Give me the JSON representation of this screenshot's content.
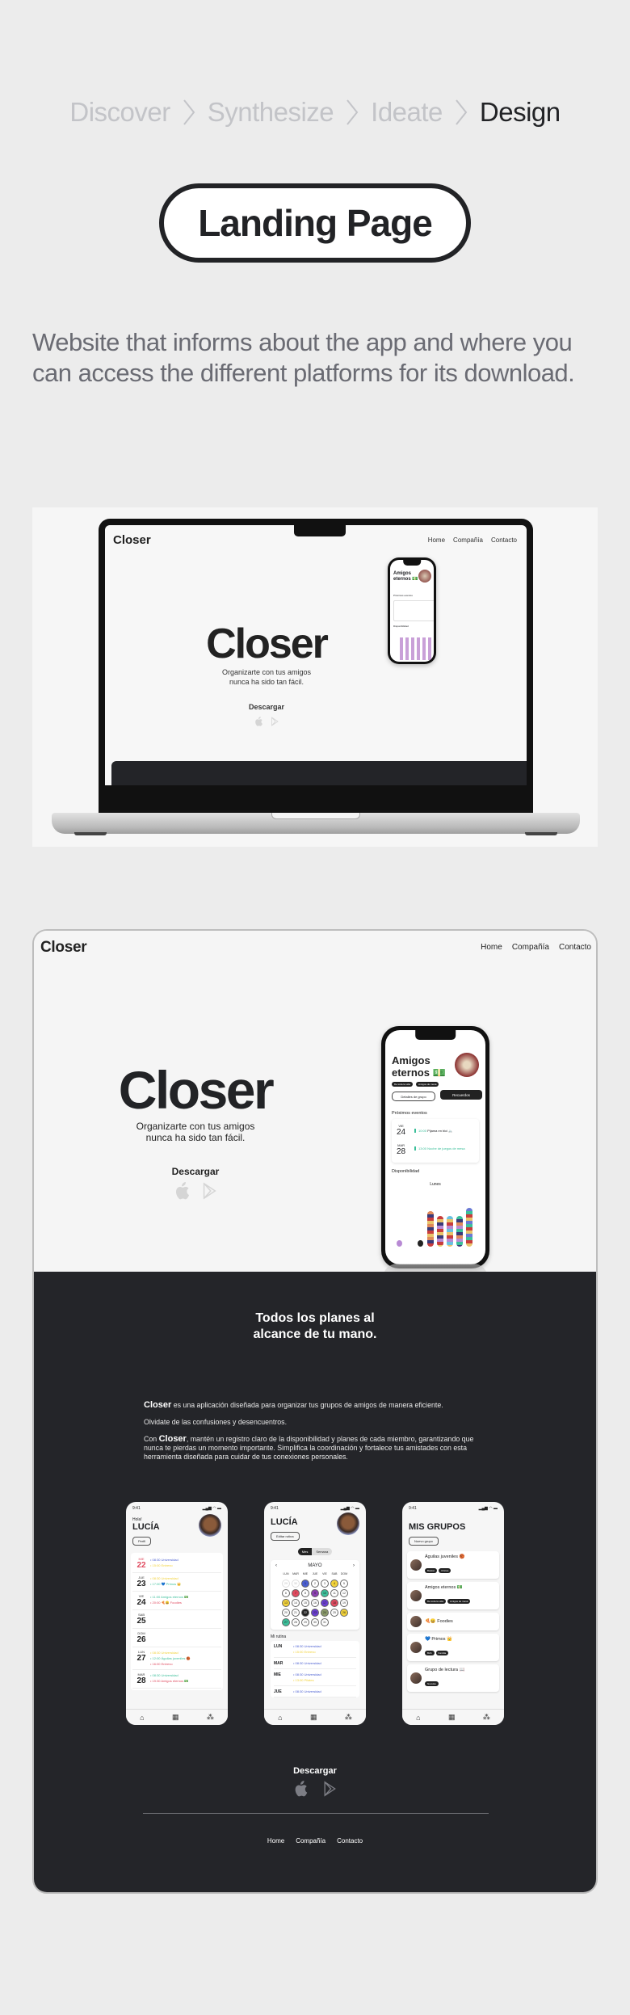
{
  "breadcrumb": {
    "items": [
      "Discover",
      "Synthesize",
      "Ideate",
      "Design"
    ],
    "active_index": 3
  },
  "section_title": "Landing Page",
  "description": "Website that informs about the app and where you can access the different platforms for its download.",
  "site": {
    "logo": "Closer",
    "nav": [
      "Home",
      "Compañía",
      "Contacto"
    ],
    "hero_title": "Closer",
    "hero_subtitle_line1": "Organizarte con tus amigos",
    "hero_subtitle_line2": "nunca ha sido tan fácil.",
    "download_label": "Descargar",
    "store_icons": [
      "apple-icon",
      "google-play-icon"
    ],
    "tagline_line1": "Todos los planes al",
    "tagline_line2": "alcance de tu mano.",
    "about": {
      "p1_brand": "Closer",
      "p1_text": " es una aplicación diseñada para organizar tus grupos de amigos de manera eficiente.",
      "p2": "Olvidate de las confusiones y desencuentros.",
      "p3_prefix": "Con ",
      "p3_brand": "Closer",
      "p3_text": ", mantén un registro claro de la disponibilidad y planes de cada miembro, garantizando que nunca te pierdas un momento importante. Simplifica la coordinación y fortalece tus amistades con esta herramienta diseñada para cuidar de tus conexiones personales."
    },
    "footer_download_label": "Descargar",
    "footer_nav": [
      "Home",
      "Compañía",
      "Contacto"
    ]
  },
  "hero_phone": {
    "group_title_line1": "Amigos",
    "group_title_line2": "eternos 💵",
    "tags": [
      "De toda la vida",
      "Amigos de mesa"
    ],
    "btn_details": "Detalles de grupo",
    "btn_memories": "Recuerdos",
    "events_title": "Próximos eventos",
    "events": [
      {
        "day": "VIE",
        "num": "24",
        "time": "10:00",
        "title": "Pijama en bici 🚲"
      },
      {
        "day": "MAR",
        "num": "28",
        "time": "13:00",
        "title": "Noche de juegos de mesa"
      }
    ],
    "availability_title": "Disponibilidad",
    "availability_day": "Lunes"
  },
  "screens": {
    "home": {
      "time": "9:41",
      "greeting": "Hola!",
      "name": "LUCÍA",
      "profile_btn": "Perfil",
      "days": [
        {
          "day": "MIE",
          "num": "22",
          "events": [
            "08:30 Universidad",
            "15:00 Entreno"
          ],
          "highlight": true
        },
        {
          "day": "JUE",
          "num": "23",
          "events": [
            "08:30 Universidad",
            "17:00 💙 Primos 👑"
          ]
        },
        {
          "day": "VIE",
          "num": "24",
          "events": [
            "11:00 Amigos eternos 💵",
            "20:00 🍕😀 Foodies"
          ]
        },
        {
          "day": "SAB",
          "num": "25",
          "events": []
        },
        {
          "day": "DOM",
          "num": "26",
          "events": []
        },
        {
          "day": "LUN",
          "num": "27",
          "events": [
            "08:30 Universidad",
            "12:00 Águilas juveniles 🏀",
            "16:00 Entreno"
          ]
        },
        {
          "day": "MAR",
          "num": "28",
          "events": [
            "08:30 Universidad",
            "19:30 Amigos eternos 💵"
          ]
        }
      ]
    },
    "calendar": {
      "time": "9:41",
      "name": "LUCÍA",
      "edit_btn": "Editar rutina",
      "toggle": [
        "Mes",
        "Semana"
      ],
      "month": "MAYO",
      "weekdays": [
        "LUN",
        "MAR",
        "MIE",
        "JUE",
        "VIE",
        "SAB",
        "DOM"
      ],
      "days": [
        "29",
        "30",
        "1",
        "2",
        "3",
        "4",
        "5",
        "6",
        "7",
        "8",
        "9",
        "10",
        "11",
        "12",
        "13",
        "14",
        "15",
        "16",
        "17",
        "18",
        "19",
        "20",
        "21",
        "22",
        "23",
        "24",
        "25",
        "26",
        "27",
        "28",
        "29",
        "30",
        "31"
      ],
      "routine_title": "Mi rutina",
      "routine": [
        {
          "day": "LUN",
          "items": [
            "08:30 Universidad",
            "15:00 Entreno"
          ]
        },
        {
          "day": "MAR",
          "items": [
            "08:30 Universidad"
          ]
        },
        {
          "day": "MIE",
          "items": [
            "08:30 Universidad",
            "13:00 Pilates"
          ]
        },
        {
          "day": "JUE",
          "items": [
            "08:30 Universidad"
          ]
        }
      ]
    },
    "groups": {
      "time": "9:41",
      "title": "MIS GRUPOS",
      "new_btn": "Nuevo grupo",
      "list": [
        {
          "name": "Águilas juveniles 🏀",
          "tags": [
            "Basket",
            "Chicas"
          ]
        },
        {
          "name": "Amigos eternos 💵",
          "tags": [
            "De toda la vida",
            "Amigos de mesa"
          ]
        },
        {
          "name": "🍕😀 Foodies",
          "tags": []
        },
        {
          "name": "💙 Primos 👑",
          "tags": [
            "BsS",
            "Familia"
          ]
        },
        {
          "name": "Grupo de lectura 📖",
          "tags": [
            "Novelas"
          ]
        }
      ]
    }
  },
  "colors": {
    "page_bg": "#ececec",
    "dark_section": "#242529",
    "text_dark": "#222326",
    "text_muted": "#6a6b73",
    "crumb_inactive": "#c3c4c8",
    "event_green": "#3bbf9a",
    "event_red": "#e04a5f",
    "event_blue": "#4b5fd1",
    "event_yellow": "#f2d23a"
  }
}
